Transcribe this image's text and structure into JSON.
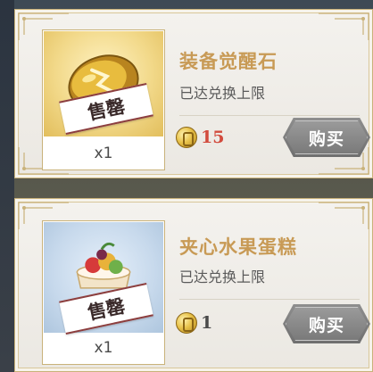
{
  "items": [
    {
      "name": "装备觉醒石",
      "status": "已达兑换上限",
      "quantity": "x1",
      "price": "15",
      "buy_label": "购买",
      "sold_label": "售罄",
      "price_color": "#d24b3d",
      "art_icon": "awakening-stone-icon"
    },
    {
      "name": "夹心水果蛋糕",
      "status": "已达兑换上限",
      "quantity": "x1",
      "price": "1",
      "buy_label": "购买",
      "sold_label": "售罄",
      "price_color": "#4a4a4a",
      "art_icon": "fruit-cake-icon"
    }
  ],
  "colors": {
    "title": "#c89a55",
    "border_gold": "#c9b27a",
    "button_gray": "#7a7a7a"
  }
}
